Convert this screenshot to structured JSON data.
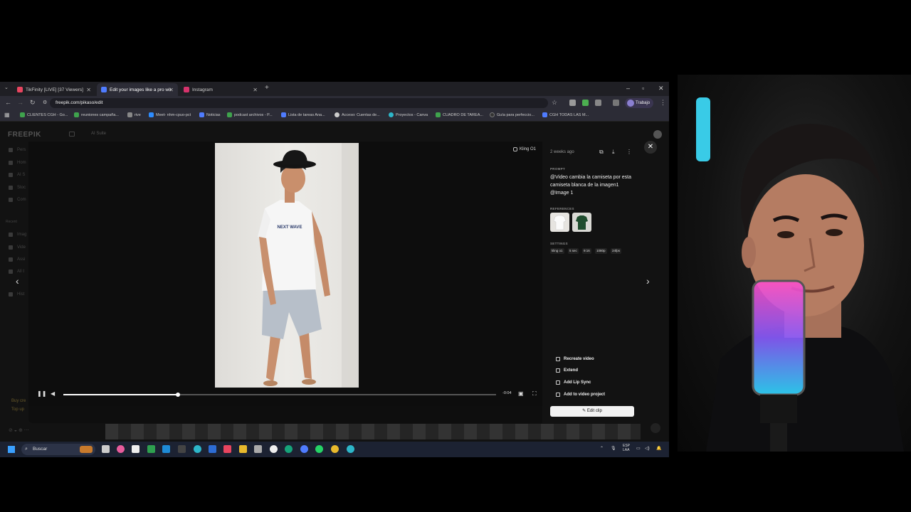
{
  "tabs": [
    {
      "label": "TikFinity [LIVE] [37 Viewers]",
      "active": false,
      "favicon_color": "#e8455f"
    },
    {
      "label": "Edit your images like a pro wit",
      "active": true,
      "favicon_color": "#4f7cff"
    },
    {
      "label": "Instagram",
      "active": false,
      "favicon_color": "#d6336c"
    }
  ],
  "address_bar": {
    "url": "freepik.com/pikaso/edit"
  },
  "profile": {
    "label": "Trabajo"
  },
  "bookmarks": [
    {
      "label": "CLIENTES CGH - Go...",
      "color": "#3fa34d"
    },
    {
      "label": "reuniones campaña...",
      "color": "#3fa34d"
    },
    {
      "label": "rive",
      "color": "#888888"
    },
    {
      "label": "Meet- nhm-cpuo-pct",
      "color": "#2d8cff"
    },
    {
      "label": "Noticias",
      "color": "#4f7cff"
    },
    {
      "label": "podcast archivos - P...",
      "color": "#3fa34d"
    },
    {
      "label": "Lista de tareas Ana...",
      "color": "#4f7cff"
    },
    {
      "label": "Acceso: Cuentas de...",
      "color": "#cccccc"
    },
    {
      "label": "Proyectos - Canva",
      "color": "#2db6c9"
    },
    {
      "label": "CUADRO DE TAREA...",
      "color": "#3fa34d"
    },
    {
      "label": "Guía para perfeccio...",
      "color": "#333333"
    },
    {
      "label": "CGH TODAS LAS M...",
      "color": "#4f7cff"
    }
  ],
  "app": {
    "logo": "FREEPIK",
    "suite": "AI Suite",
    "sidebar": [
      "Pers",
      "Hom",
      "AI S",
      "Stoc",
      "Com",
      "Recent",
      "Imag",
      "Vide",
      "Assi",
      "All t",
      "Hist"
    ],
    "footer_promo": [
      "Buy cre",
      "Top up"
    ]
  },
  "modal": {
    "model_badge": "Kling O1",
    "date": "2 weeks ago",
    "prompt_label": "PROMPT",
    "prompt_text": "@Video cambia la camiseta por esta camiseta blanca de la imagen1 @Image 1",
    "references_label": "REFERENCES",
    "settings_label": "SETTINGS",
    "settings": [
      "kling o1",
      "5 sec",
      "9:16",
      "1080p",
      "24fps"
    ],
    "actions": [
      "Recreate video",
      "Extend",
      "Add Lip Sync",
      "Add to video project"
    ],
    "edit_clip": "Edit clip",
    "video": {
      "time_remaining": "-0:04",
      "progress": 0.265,
      "shirt_print": "NEXT WAVE"
    }
  },
  "taskbar": {
    "search": "Buscar",
    "language": "ESP",
    "region": "LAA",
    "icon_colors": [
      "#c87a2c",
      "#cccccc",
      "#e85c9c",
      "#eeeeee",
      "#2ea04f",
      "#1e8bd6",
      "#444",
      "#2db6c9",
      "#2d6cd4",
      "#e8455f",
      "#e8b92c",
      "#aaa",
      "#eeeeee",
      "#16a37a",
      "#4f7cff",
      "#25d366",
      "#2db6c9"
    ]
  }
}
